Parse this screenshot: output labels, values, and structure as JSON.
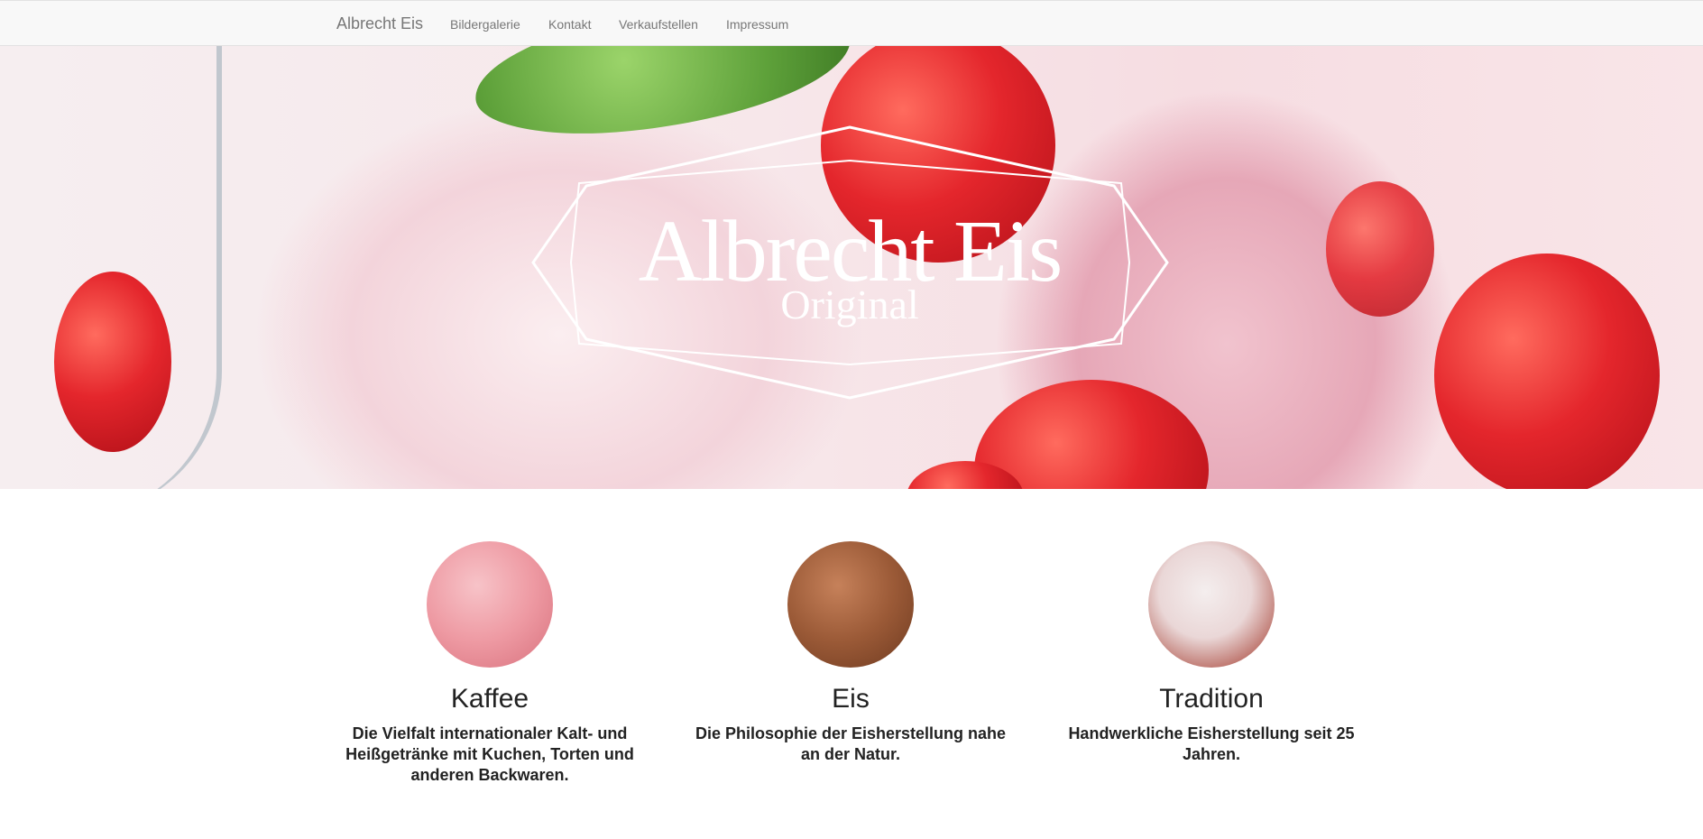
{
  "navbar": {
    "brand": "Albrecht Eis",
    "links": [
      "Bildergalerie",
      "Kontakt",
      "Verkaufstellen",
      "Impressum"
    ]
  },
  "hero": {
    "title": "Albrecht Eis",
    "subtitle": "Original"
  },
  "features": [
    {
      "title": "Kaffee",
      "text": "Die Vielfalt internationaler Kalt- und Heißgetränke mit Kuchen, Torten und anderen Backwaren."
    },
    {
      "title": "Eis",
      "text": "Die Philosophie der Eisherstellung nahe an der Natur."
    },
    {
      "title": "Tradition",
      "text": "Handwerkliche Eisherstellung seit 25 Jahren."
    }
  ],
  "colors": {
    "navbar_bg": "#f8f8f8",
    "nav_text": "#777777",
    "hero_pink": "#f3d4db",
    "strawberry_red": "#e4262c"
  }
}
